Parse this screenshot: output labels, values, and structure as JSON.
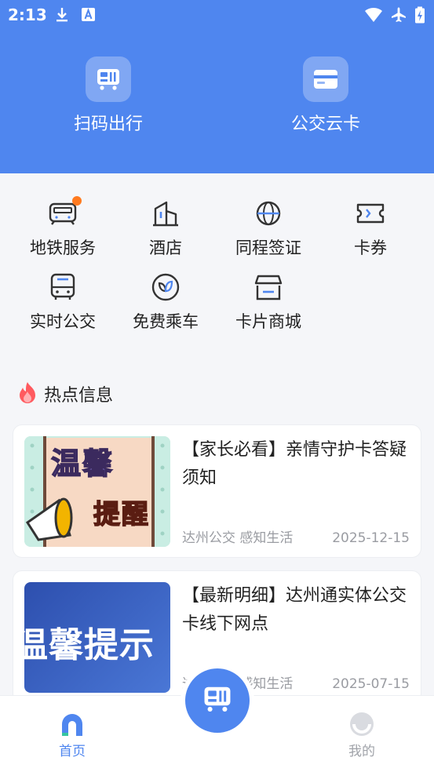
{
  "status": {
    "time": "2:13"
  },
  "top_actions": [
    {
      "label": "扫码出行"
    },
    {
      "label": "公交云卡"
    }
  ],
  "grid": [
    {
      "label": "地铁服务",
      "icon": "metro-icon",
      "badge": true
    },
    {
      "label": "酒店",
      "icon": "hotel-icon"
    },
    {
      "label": "同程签证",
      "icon": "globe-icon"
    },
    {
      "label": "卡券",
      "icon": "coupon-icon"
    },
    {
      "label": "实时公交",
      "icon": "bus-icon"
    },
    {
      "label": "免费乘车",
      "icon": "leaf-icon"
    },
    {
      "label": "卡片商城",
      "icon": "store-icon"
    }
  ],
  "hot": {
    "title": "热点信息"
  },
  "news": [
    {
      "title": "【家长必看】亲情守护卡答疑须知",
      "source": "达州公交 感知生活",
      "date": "2025-12-15",
      "thumb_text_1": "温馨",
      "thumb_text_2": "提醒"
    },
    {
      "title": "【最新明细】达州通实体公交卡线下网点",
      "source": "达州公交 感知生活",
      "date": "2025-07-15",
      "thumb_text_1": "温馨提示"
    }
  ],
  "tabbar": {
    "home": "首页",
    "mine": "我的"
  },
  "colors": {
    "primary": "#4f86ef",
    "accent": "#ff7a1f"
  }
}
